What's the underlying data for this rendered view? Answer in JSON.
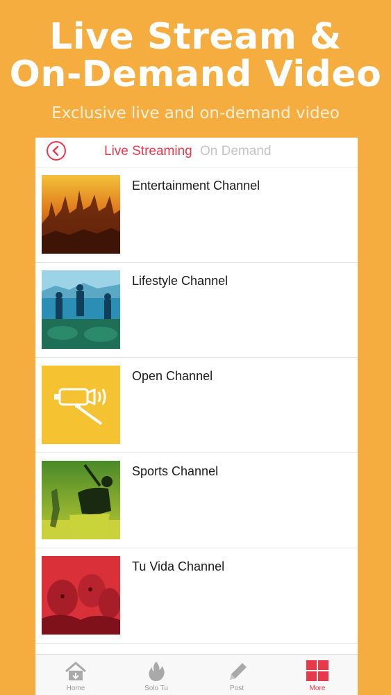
{
  "promo": {
    "title_line1": "Live Stream &",
    "title_line2": "On-Demand Video",
    "subtitle": "Exclusive live and on-demand video"
  },
  "header": {
    "back_icon": "back-arrow-circle-icon",
    "tab_live": "Live Streaming",
    "tab_on_demand": "On Demand",
    "active_tab": "Live Streaming"
  },
  "channels": [
    {
      "label": "Entertainment Channel",
      "thumb": "concert-crowd-image"
    },
    {
      "label": "Lifestyle Channel",
      "thumb": "rooftop-party-image"
    },
    {
      "label": "Open Channel",
      "thumb": "camera-broadcast-icon"
    },
    {
      "label": "Sports Channel",
      "thumb": "baseball-batter-image"
    },
    {
      "label": "Tu Vida Channel",
      "thumb": "friends-selfie-image"
    }
  ],
  "tabbar": {
    "items": [
      {
        "label": "Home",
        "icon": "home-icon"
      },
      {
        "label": "Solo Tu",
        "icon": "flame-icon"
      },
      {
        "label": "Post",
        "icon": "pencil-icon"
      },
      {
        "label": "More",
        "icon": "grid-icon"
      }
    ],
    "active": "More"
  },
  "colors": {
    "background": "#f6ad3f",
    "accent": "#e8394a",
    "inactive_tab": "#c4c4c4",
    "open_channel_yellow": "#f5c331"
  }
}
